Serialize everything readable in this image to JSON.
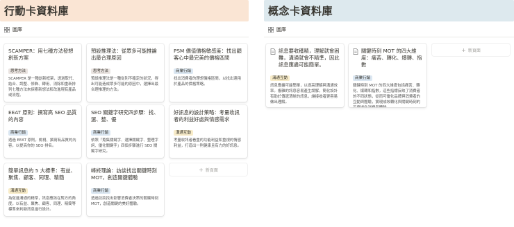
{
  "left": {
    "title": "行動卡資料庫",
    "view_label": "圖庫",
    "new_label": "新頁面",
    "cards": [
      {
        "title": "SCAMPER：用七種方法發想創新方案",
        "tag": "思考方法",
        "tag_color": "#eae4e1",
        "desc": "SCAMPER 是一種創新框架，透過取代、結合、調整、修飾、轉用、消除和重新排列七種方法來探索新想法和改進現有產品或流程。"
      },
      {
        "title": "預設推理法：從眾多可能推論出最合理原因",
        "tag": "思考方法",
        "tag_color": "#eae4e1",
        "desc": "預設推理法是一種從別不確定的狀況，得出可能造成眾多可能的原因中，選擇出最合理推理的方法。"
      },
      {
        "title": "PSM 價值價格敏感度：找出顧客心中最完美的價格區間",
        "tag": "商業行銷",
        "tag_color": "#dbe7f2",
        "desc": "找出消費者的理想價格區間，以找出適用於產品的價格策略。"
      },
      {
        "title": "EEAT 原則：撰寫高 SEO 品質的內容",
        "tag": "商業行銷",
        "tag_color": "#dbe7f2",
        "desc": "透過 EEAT 原則，檢視、撰寫有品質的內容，以提高你的 SEO 排名。"
      },
      {
        "title": "SEO 關鍵字研究四步驟：找、選、整、優",
        "tag": "商業行銷",
        "tag_color": "#dbe7f2",
        "desc": "依照「蒐集關鍵字、選擇關鍵字、整理字詞、優化關鍵字」四個步驟進行 SEO 關鍵字研究。"
      },
      {
        "title": "好訊息的設計策略：考量收訊者的利益好處與情感需求",
        "tag": "溝通互動",
        "tag_color": "#f8ecc9",
        "desc": "考量收訊者看重的功能利益和重視的情感利益，打造出一則健康且有力的好訊息。"
      },
      {
        "title": "簡單訊息的 5 大標準：有益、聚焦、顧客、同理、精簡",
        "tag": "溝通互動",
        "tag_color": "#f8ecc9",
        "desc": "為促進溝通的精準，訊息應該在對方的角度，以有益、聚焦、顧客、同理、精簡等標準來判斷訊息進行設計。"
      },
      {
        "title": "峰終理論：訪談找出關鍵時刻 MOT，創造關鍵體驗",
        "tag": "商業行銷",
        "tag_color": "#dbe7f2",
        "desc": "透過訪談找出影響消費者決策的關鍵時刻 MOT，創造關鍵的美好體驗。"
      }
    ]
  },
  "right": {
    "title": "概念卡資料庫",
    "view_label": "圖庫",
    "new_label": "新頁面",
    "cards": [
      {
        "title": "訊息要收穫精，理解就會困難，溝通就會不精準，因此訊息應盡可能簡單。",
        "tag": "溝通互動",
        "tag_color": "#f8ecc9",
        "desc": "訊息應盡可能簡單，以提高理解與溝通效率。複雜的訊息容易產生誤解，簡化設計有助於傳遞清晰的訊息，讓接收者更容易做出理解。"
      },
      {
        "title": "關鍵時刻 MOT 的四大維度：痛苦、轉化、爆轉、指數",
        "tag": "商業行銷",
        "tag_color": "#dbe7f2",
        "desc": "關鍵時刻 MOT 的四大維度包括痛苦、轉化、爆轉和指數，這些指標反映了消費者的不同狀態，從而可優化品牌與消費者的互動與體驗，實現成效轉化與關鍵時刻的深度提升消費者體驗。"
      }
    ]
  },
  "icons": {
    "view": "grid-icon",
    "doc": "document-icon",
    "plus": "plus-icon"
  }
}
